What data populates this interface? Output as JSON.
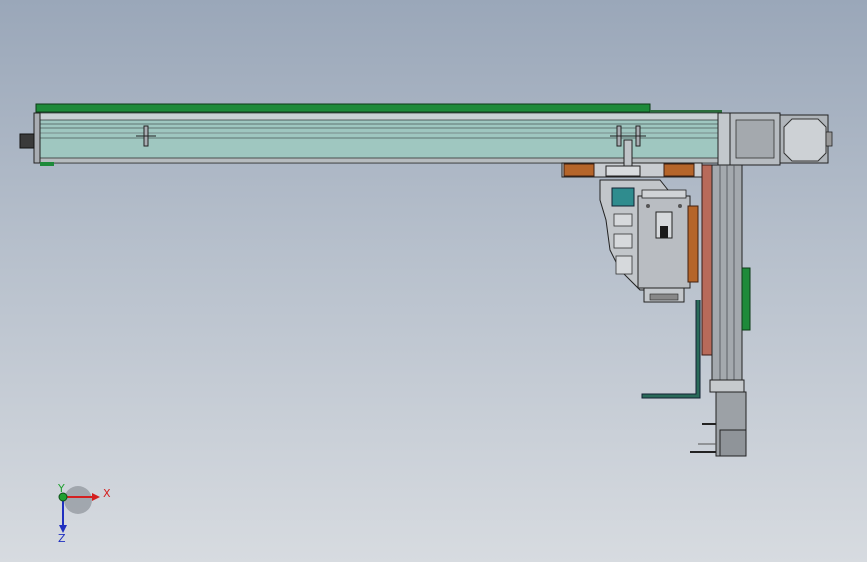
{
  "view": {
    "type": "CAD assembly drawing (front orthographic view)",
    "colors": {
      "background_top": "#9aa7b9",
      "background_bottom": "#d7dbe0",
      "rail_green": "#1e8a3a",
      "rail_body": "#9fc7c0",
      "frame_gray": "#a9adb3",
      "bracket_brown": "#b5652a",
      "accent_teal": "#2f8c8e"
    }
  },
  "triad": {
    "x_label": "X",
    "y_label": "Y",
    "z_label": "Z",
    "x_color": "#d42020",
    "y_color": "#20a030",
    "z_color": "#2030c0"
  }
}
